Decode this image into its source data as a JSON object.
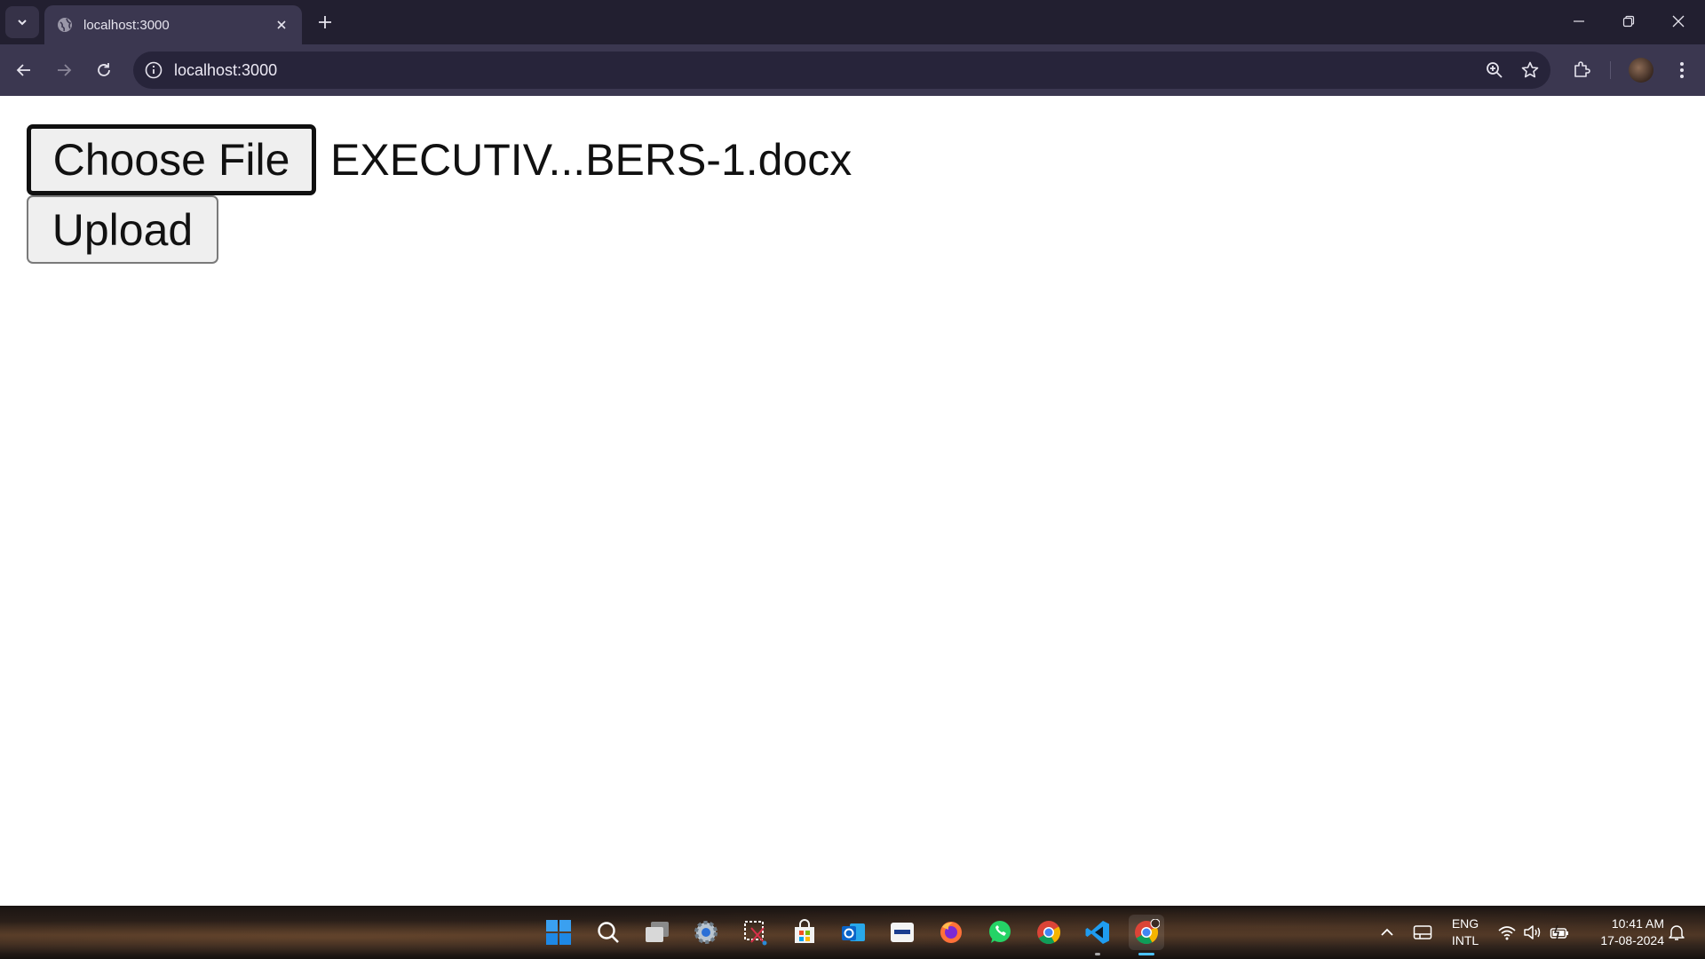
{
  "browser": {
    "tab_title": "localhost:3000",
    "url": "localhost:3000"
  },
  "page": {
    "choose_file_label": "Choose File",
    "selected_file_name": "EXECUTIV...BERS-1.docx",
    "upload_label": "Upload"
  },
  "taskbar": {
    "apps": [
      "start-icon",
      "search-icon",
      "task-view-icon",
      "settings-icon",
      "snipping-tool-icon",
      "store-icon",
      "outlook-icon",
      "app-icon",
      "firefox-icon",
      "whatsapp-icon",
      "chrome-icon",
      "vscode-icon",
      "chrome-profile-icon"
    ],
    "language": "ENG",
    "keyboard": "INTL",
    "time": "10:41 AM",
    "date": "17-08-2024"
  }
}
